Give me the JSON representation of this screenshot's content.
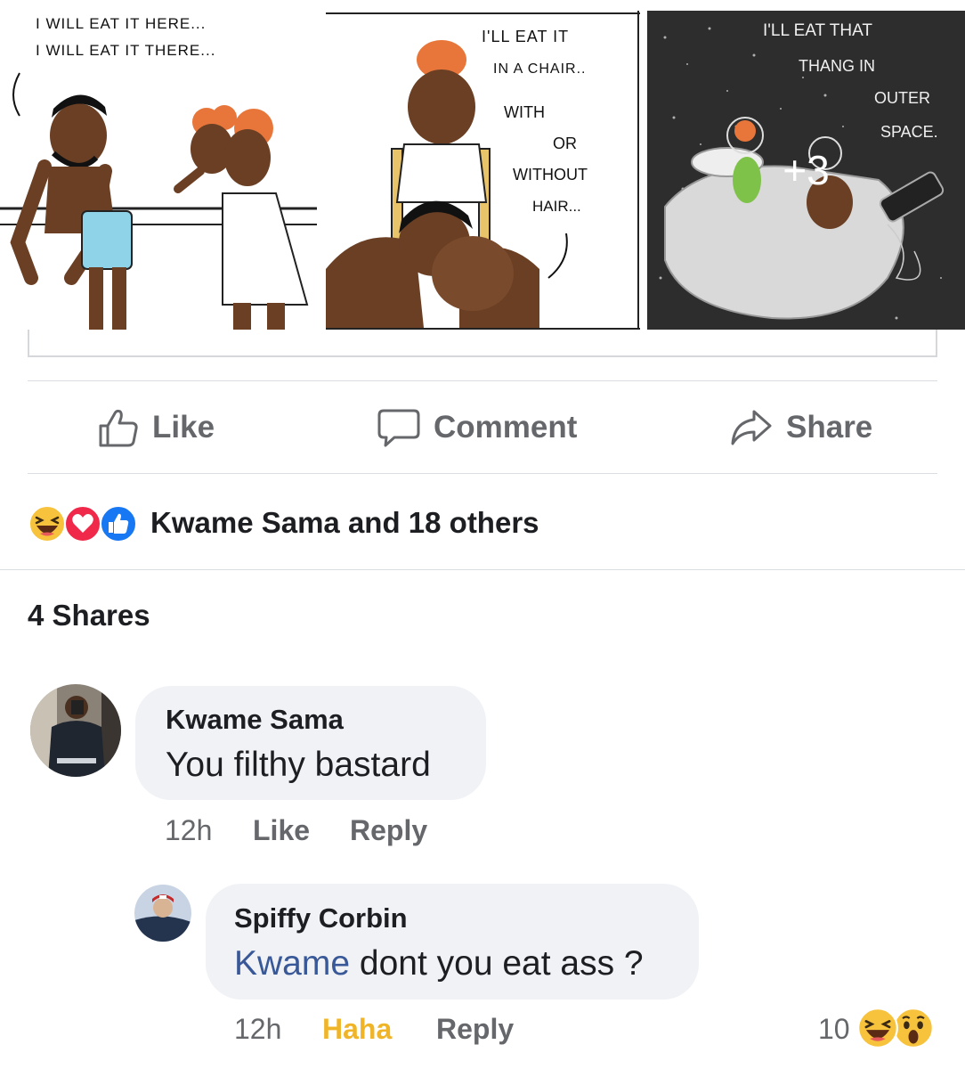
{
  "photos": {
    "panel1_caption": [
      "I WILL EAT IT HERE...",
      "I WILL EAT IT THERE..."
    ],
    "panel2_caption": [
      "I'LL EAT IT",
      "IN A CHAIR..",
      "WITH",
      "OR",
      "WITHOUT",
      "HAIR..."
    ],
    "panel3_caption": [
      "I'LL EAT THAT",
      "THANG IN",
      "OUTER",
      "SPACE."
    ],
    "more_count": "+3"
  },
  "actions": {
    "like_label": "Like",
    "comment_label": "Comment",
    "share_label": "Share",
    "icon_color": "#65676b"
  },
  "reactions": {
    "icons": [
      "haha-icon",
      "love-icon",
      "like-icon"
    ],
    "summary": "Kwame Sama and 18 others"
  },
  "shares": {
    "label": "4 Shares"
  },
  "comments": [
    {
      "author": "Kwame Sama",
      "text": "You filthy bastard",
      "time": "12h",
      "like_label": "Like",
      "reply_label": "Reply"
    },
    {
      "author": "Spiffy Corbin",
      "mention": "Kwame",
      "text": " dont you eat ass ?",
      "time": "12h",
      "reaction_label": "Haha",
      "reply_label": "Reply",
      "reaction_count": "10",
      "reaction_icons": [
        "haha-icon",
        "wow-icon"
      ]
    }
  ],
  "colors": {
    "mention": "#385898",
    "haha": "#f0b428",
    "bubble": "#f0f2f5",
    "secondary_text": "#65676b"
  }
}
